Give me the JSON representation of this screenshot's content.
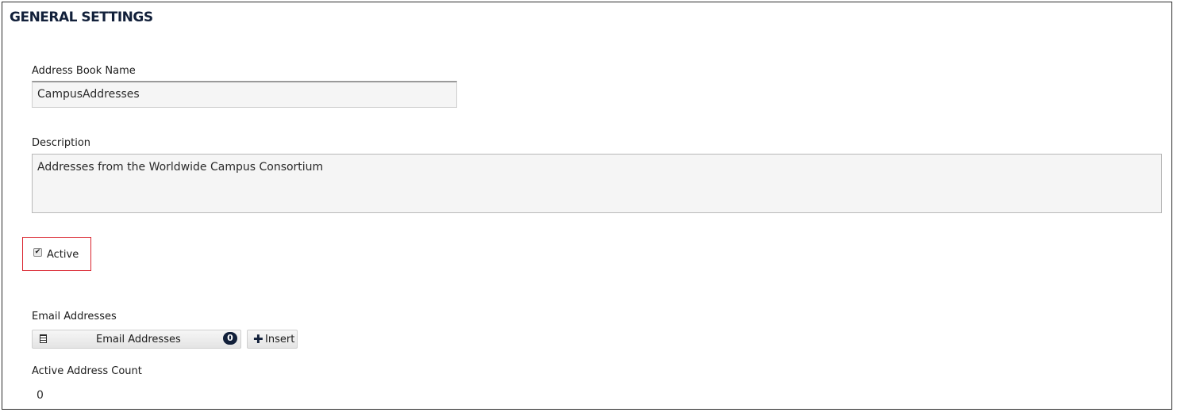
{
  "section": {
    "title": "GENERAL SETTINGS"
  },
  "address_book_name": {
    "label": "Address Book Name",
    "value": "CampusAddresses"
  },
  "description": {
    "label": "Description",
    "value": "Addresses from the Worldwide Campus Consortium"
  },
  "active": {
    "label": "Active",
    "checked": true,
    "check_glyph": "✔",
    "highlight_color": "#d9232d"
  },
  "email_addresses": {
    "label": "Email Addresses",
    "button_label": "Email Addresses",
    "button_icon": "list-icon",
    "count": "0",
    "insert_icon": "plus-icon",
    "insert_glyph": "✚",
    "insert_label": "Insert"
  },
  "active_address_count": {
    "label": "Active Address Count",
    "value": "0"
  },
  "colors": {
    "title": "#12203a",
    "badge": "#12203a",
    "input_bg": "#f5f5f5"
  }
}
